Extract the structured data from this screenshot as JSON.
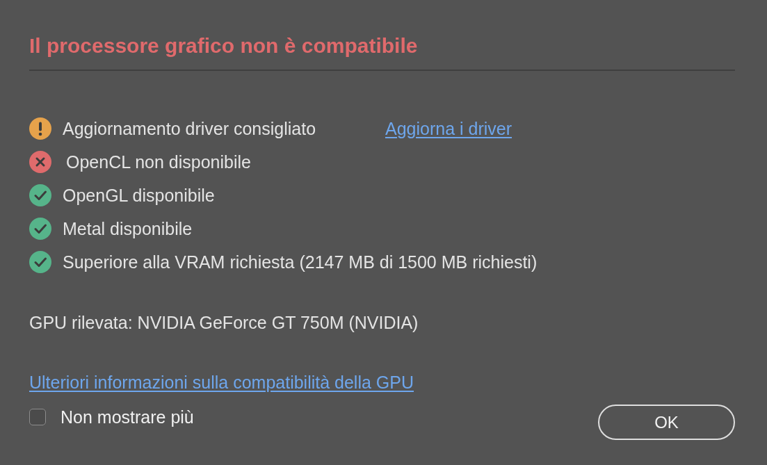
{
  "dialog": {
    "title": "Il processore grafico non è compatibile",
    "checks": [
      {
        "kind": "warning",
        "label": "Aggiornamento driver consigliato",
        "link": "Aggiorna i driver"
      },
      {
        "kind": "error",
        "label": "OpenCL non disponibile"
      },
      {
        "kind": "ok",
        "label": "OpenGL disponibile"
      },
      {
        "kind": "ok",
        "label": "Metal disponibile"
      },
      {
        "kind": "ok",
        "label": "Superiore alla VRAM richiesta (2147 MB di 1500 MB richiesti)"
      }
    ],
    "gpu_detected": "GPU rilevata: NVIDIA GeForce GT 750M (NVIDIA)",
    "info_link": "Ulteriori informazioni sulla compatibilità della GPU",
    "dont_show_again": {
      "label": "Non mostrare più",
      "checked": false
    },
    "ok_button": "OK"
  }
}
